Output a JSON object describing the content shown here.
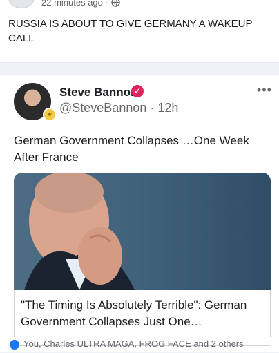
{
  "post": {
    "time": "22 minutes ago",
    "text": "RUSSIA IS ABOUT TO GIVE GERMANY A WAKEUP CALL"
  },
  "shared": {
    "author_name": "Steve Bannon",
    "handle": "@SteveBannon",
    "age": "· 12h",
    "more": "•••",
    "tweet_text": "German Government Collapses …One Week After France",
    "headline": "\"The Timing Is Absolutely Terrible\": German Government Collapses Just One…"
  },
  "reactions": {
    "text": "You, Charles ULTRA MAGA, FROG FACE and 2 others"
  },
  "colors": {
    "verified": "#e0245e",
    "like": "#1877f2",
    "muted": "#65676b"
  }
}
